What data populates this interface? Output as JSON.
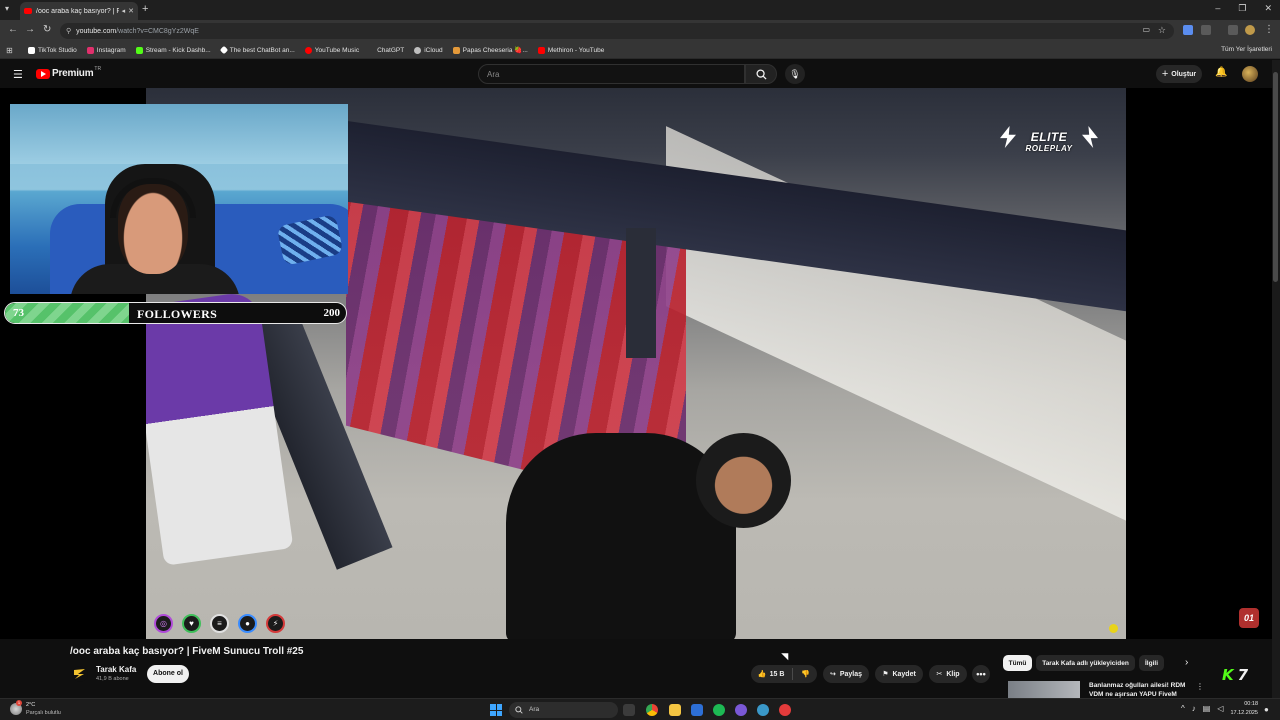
{
  "browser": {
    "tab_title": "/ooc araba kaç basıyor? | Fi",
    "address_host": "youtube.com",
    "address_path": "/watch?v=CMC8gYz2WqE",
    "bookmarks": [
      {
        "label": "TikTok Studio",
        "color": "#ffffff"
      },
      {
        "label": "Instagram",
        "color": "#e1306c"
      },
      {
        "label": "Stream - Kick Dashb...",
        "color": "#53fc18"
      },
      {
        "label": "The best ChatBot an...",
        "color": "#ffffff"
      },
      {
        "label": "YouTube Music",
        "color": "#ff0000"
      },
      {
        "label": "ChatGPT",
        "color": "#10a37f"
      },
      {
        "label": "iCloud",
        "color": "#bfbfbf"
      },
      {
        "label": "Papas Cheeseria 🍓...",
        "color": "#e59a3a"
      },
      {
        "label": "Methiron - YouTube",
        "color": "#ff0000"
      }
    ],
    "all_bookmarks": "Tüm Yer İşaretleri"
  },
  "youtube": {
    "logo_text": "Premium",
    "logo_region": "TR",
    "search_placeholder": "Ara",
    "create_label": "Oluştur"
  },
  "stream_overlay": {
    "follower_current": "73",
    "follower_label": "FOLLOWERS",
    "follower_goal": "200",
    "follower_progress": 0.365,
    "watermark_line1": "ELITE",
    "watermark_line2": "ROLEPLAY",
    "corner_badge": "01"
  },
  "video": {
    "title": "/ooc araba kaç basıyor? | FiveM Sunucu Troll #25",
    "channel_name": "Tarak Kafa",
    "subscribers": "41,9 B abone",
    "subscribe_label": "Abone ol",
    "like_count": "15 B",
    "share_label": "Paylaş",
    "save_label": "Kaydet",
    "clip_label": "Klip",
    "more_label": "•••"
  },
  "sidebar": {
    "chips": [
      "Tümü",
      "Tarak Kafa adlı yükleyiciden",
      "İlgili"
    ],
    "recommended_title_1": "Banlanmaz oğulları ailesi! RDM",
    "recommended_title_2": "VDM ne aşırsan YAPU FiveM"
  },
  "taskbar": {
    "temperature": "2°C",
    "weather_desc": "Parçalı bulutlu",
    "weather_badge": "1",
    "search_placeholder": "Ara",
    "time": "00:18",
    "date": "17.12.2025"
  },
  "colors": {
    "accent_red": "#ff0000",
    "kick_green": "#53fc18",
    "follower_green": "#56c26a"
  }
}
